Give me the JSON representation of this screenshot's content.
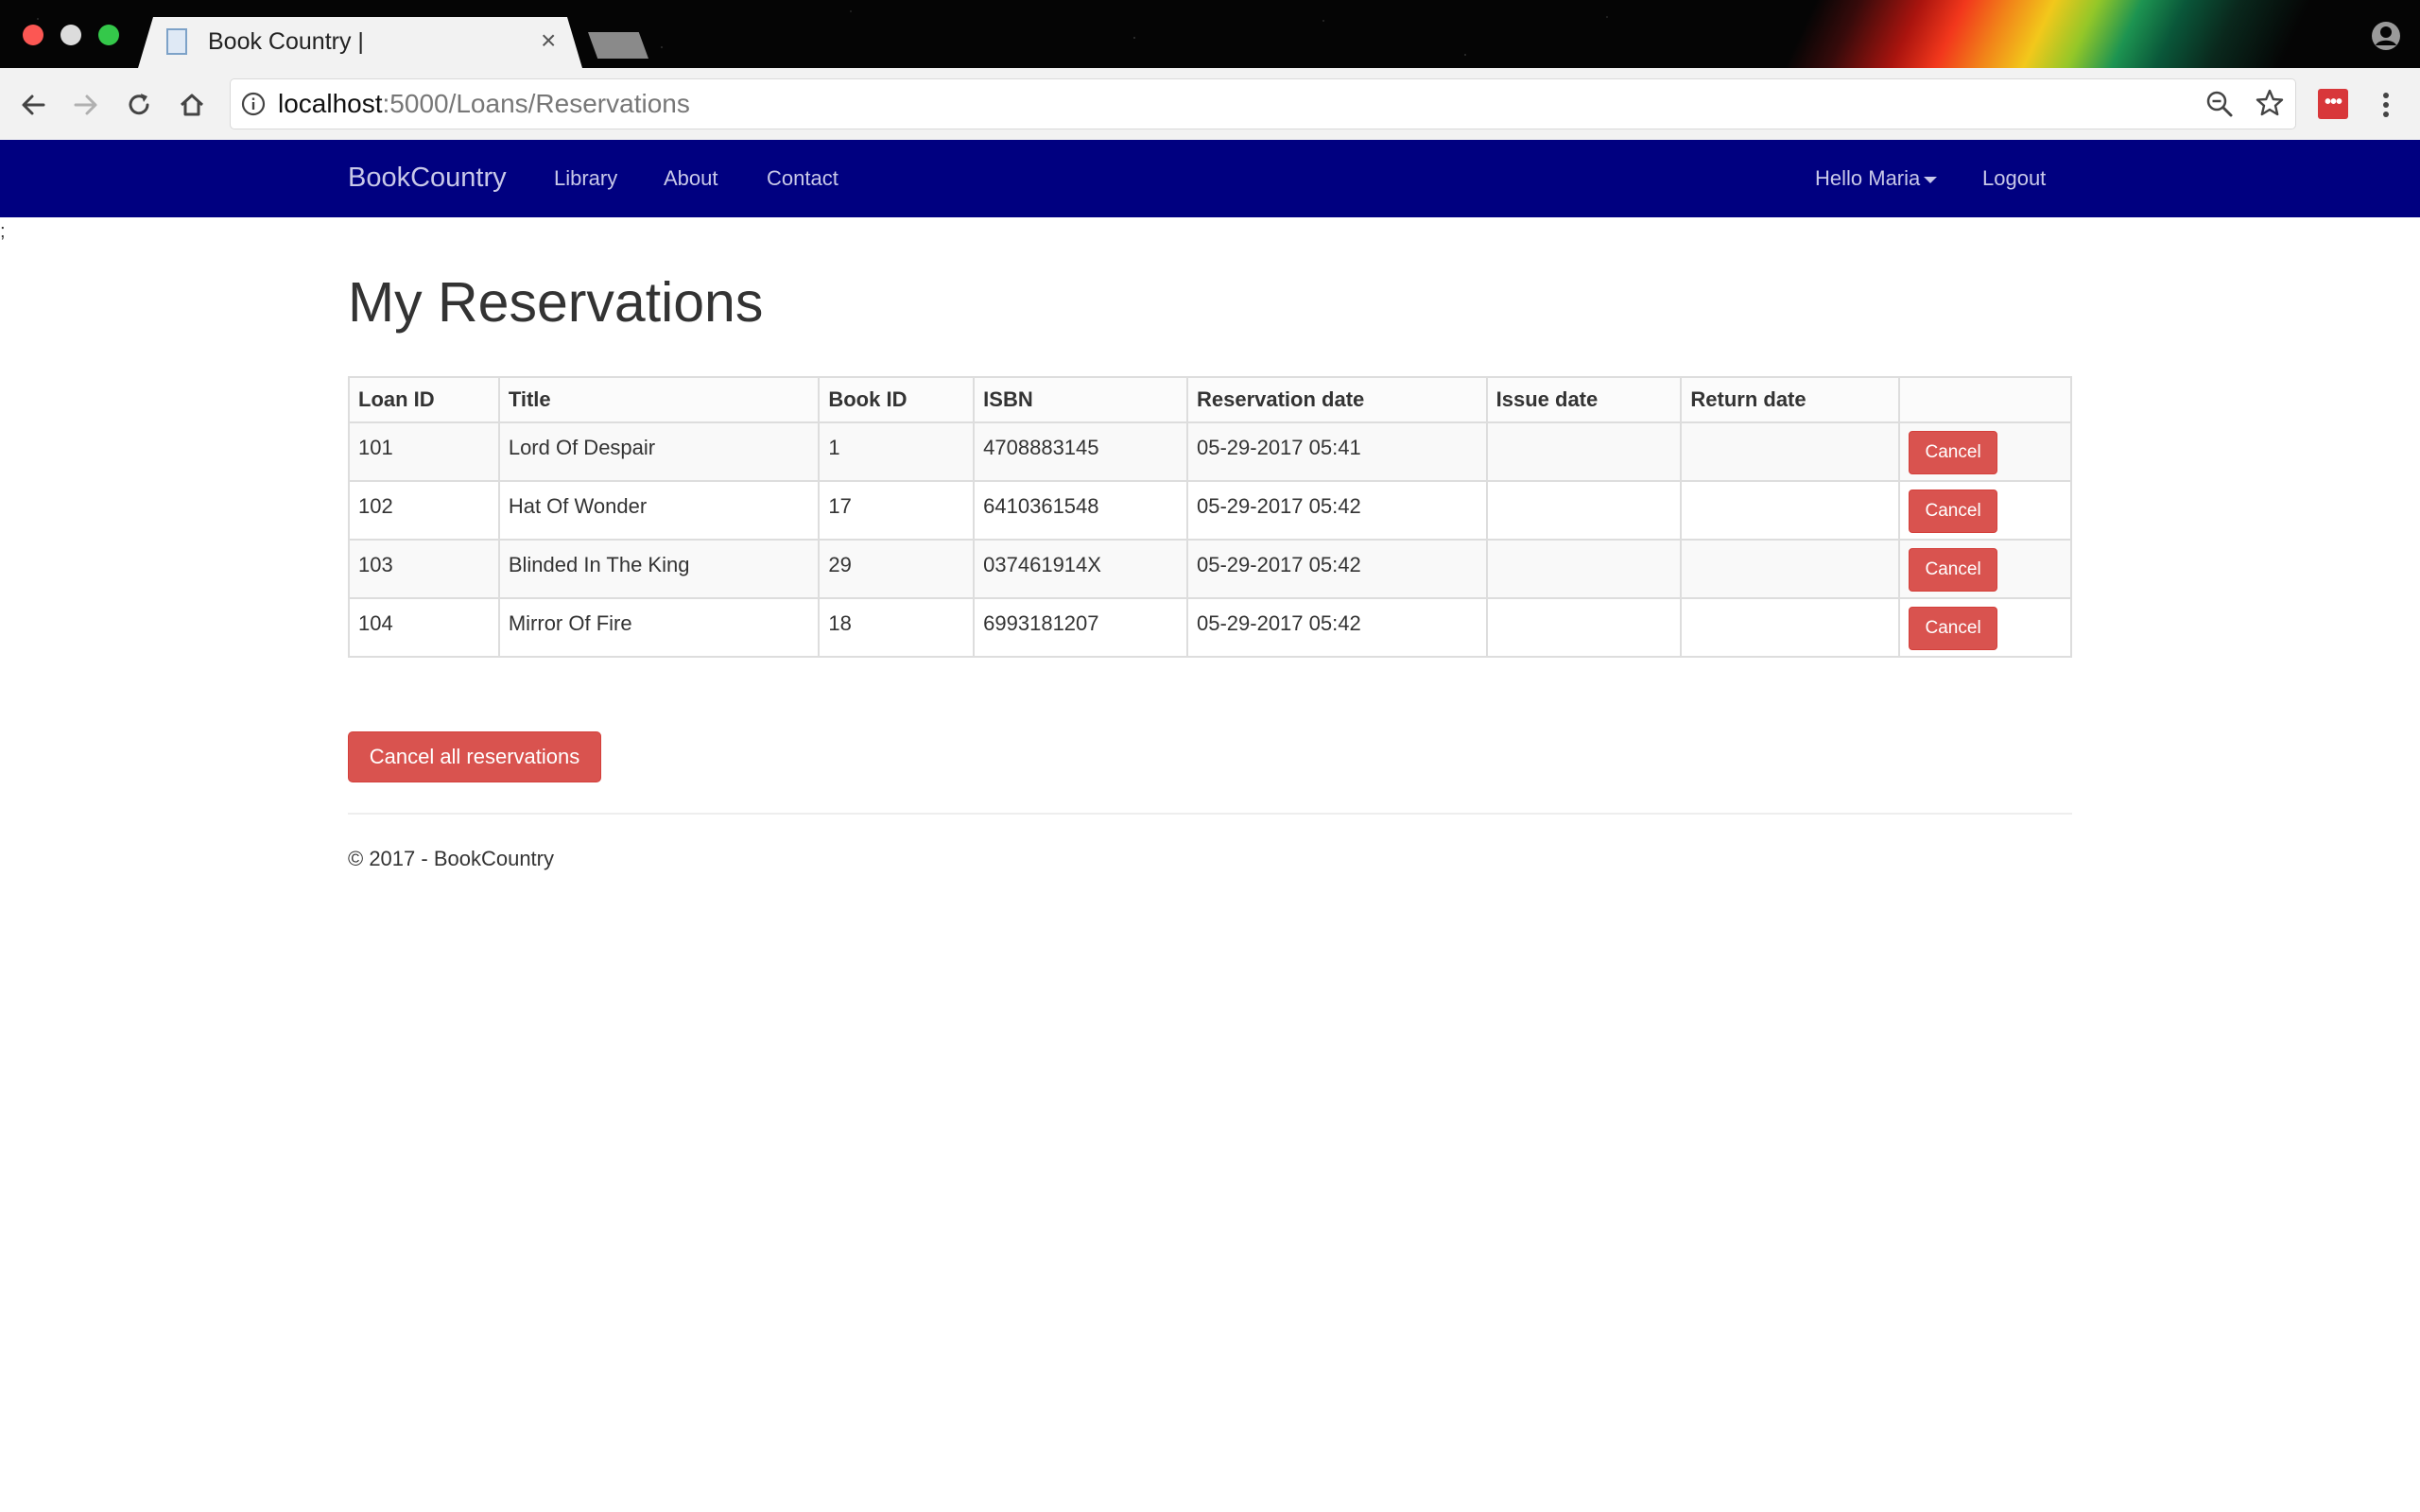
{
  "browser": {
    "tab_title": "Book Country |",
    "tab_close": "×",
    "url_host": "localhost",
    "url_rest": ":5000/Loans/Reservations",
    "extension_label": "•••"
  },
  "navbar": {
    "brand": "BookCountry",
    "links": [
      "Library",
      "About",
      "Contact"
    ],
    "user_greeting": "Hello Maria",
    "logout": "Logout",
    "color": "#000080"
  },
  "stray_text": ";",
  "page": {
    "title": "My Reservations",
    "table": {
      "headers": [
        "Loan ID",
        "Title",
        "Book ID",
        "ISBN",
        "Reservation date",
        "Issue date",
        "Return date",
        ""
      ],
      "rows": [
        {
          "loan_id": "101",
          "title": "Lord Of Despair",
          "book_id": "1",
          "isbn": "4708883145",
          "reservation_date": "05-29-2017 05:41",
          "issue_date": "",
          "return_date": "",
          "action": "Cancel"
        },
        {
          "loan_id": "102",
          "title": "Hat Of Wonder",
          "book_id": "17",
          "isbn": "6410361548",
          "reservation_date": "05-29-2017 05:42",
          "issue_date": "",
          "return_date": "",
          "action": "Cancel"
        },
        {
          "loan_id": "103",
          "title": "Blinded In The King",
          "book_id": "29",
          "isbn": "037461914X",
          "reservation_date": "05-29-2017 05:42",
          "issue_date": "",
          "return_date": "",
          "action": "Cancel"
        },
        {
          "loan_id": "104",
          "title": "Mirror Of Fire",
          "book_id": "18",
          "isbn": "6993181207",
          "reservation_date": "05-29-2017 05:42",
          "issue_date": "",
          "return_date": "",
          "action": "Cancel"
        }
      ]
    },
    "cancel_all_label": "Cancel all reservations",
    "button_color": "#d9534f"
  },
  "footer": {
    "text": "© 2017 - BookCountry"
  }
}
